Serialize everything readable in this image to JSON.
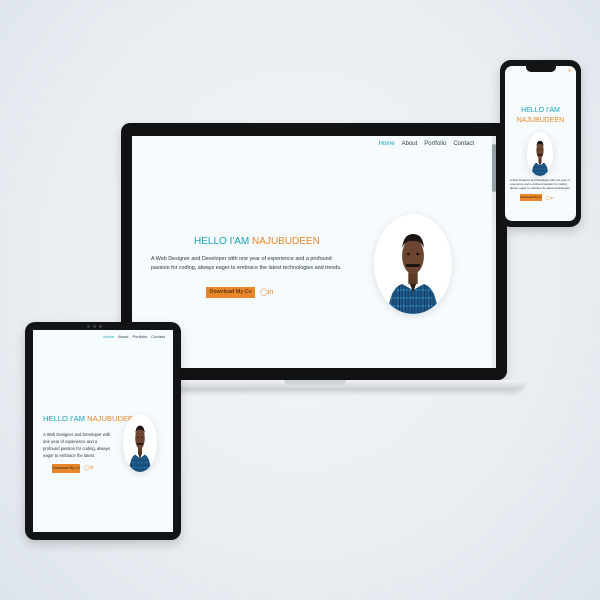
{
  "site": {
    "nav": [
      "Home",
      "About",
      "Portfolio",
      "Contact"
    ],
    "hello_prefix": "HELLO I'AM",
    "hello_name": "NAJUBUDEEN",
    "bio": "A Web Designer and Developer with one year of experience and a profound passion for coding, always eager to embrace the latest technologies and trends.",
    "cv_button": "Download My Cv",
    "linkedin": "in"
  },
  "tablet": {
    "hello_prefix": "HELLO I'AM",
    "hello_name": "NAJUBUDEEN",
    "bio": "A Web Designer and Developer with one year of experience and a profound passion for coding, always eager to embrace the latest technologies and trends.",
    "cv_button": "Download My Cv",
    "linkedin": "in",
    "nav": [
      "Home",
      "About",
      "Portfolio",
      "Contact"
    ]
  },
  "phone": {
    "hello_prefix": "HELLO I'AM",
    "hello_name": "NAJUBUDEEN",
    "bio": "A Web Designer and Developer with one year of experience and a profound passion for coding, always eager to embrace the latest technologies and trends.",
    "cv_button": "Download My Cv",
    "linkedin": "in"
  },
  "colors": {
    "accent_teal": "#1aa3b8",
    "accent_orange": "#e8862a",
    "screen_bg": "#f6fbfe"
  }
}
